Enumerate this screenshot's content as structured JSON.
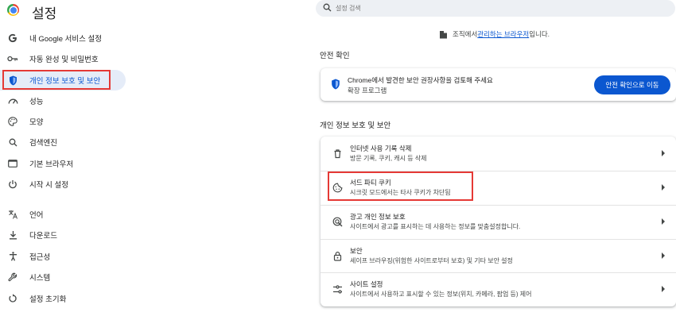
{
  "app": {
    "title": "설정"
  },
  "search": {
    "placeholder": "설정 검색"
  },
  "org_notice": {
    "prefix": "조직에서 ",
    "link": "관리하는 브라우저",
    "suffix": "입니다."
  },
  "sidebar": {
    "items": [
      {
        "label": "내 Google 서비스 설정",
        "icon": "google-g-icon"
      },
      {
        "label": "자동 완성 및 비밀번호",
        "icon": "key-icon"
      },
      {
        "label": "개인 정보 보호 및 보안",
        "icon": "shield-icon",
        "active": true
      },
      {
        "label": "성능",
        "icon": "speedometer-icon"
      },
      {
        "label": "모양",
        "icon": "palette-icon"
      },
      {
        "label": "검색엔진",
        "icon": "search-icon"
      },
      {
        "label": "기본 브라우저",
        "icon": "browser-window-icon"
      },
      {
        "label": "시작 시 설정",
        "icon": "power-icon"
      },
      {
        "label": "언어",
        "icon": "translate-icon"
      },
      {
        "label": "다운로드",
        "icon": "download-icon"
      },
      {
        "label": "접근성",
        "icon": "accessibility-icon"
      },
      {
        "label": "시스템",
        "icon": "wrench-icon"
      },
      {
        "label": "설정 초기화",
        "icon": "reset-icon"
      }
    ]
  },
  "safety_check": {
    "heading": "안전 확인",
    "title": "Chrome에서 발견한 보안 권장사항을 검토해 주세요",
    "subtitle": "확장 프로그램",
    "button": "안전 확인으로 이동"
  },
  "privacy": {
    "heading": "개인 정보 보호 및 보안",
    "rows": [
      {
        "title": "인터넷 사용 기록 삭제",
        "subtitle": "방문 기록, 쿠키, 캐시 등 삭제",
        "icon": "trash-icon"
      },
      {
        "title": "서드 파티 쿠키",
        "subtitle": "시크릿 모드에서는 타사 쿠키가 차단됨",
        "icon": "cookie-icon"
      },
      {
        "title": "광고 개인 정보 보호",
        "subtitle": "사이트에서 광고를 표시하는 데 사용하는 정보를 맞춤설정합니다.",
        "icon": "ad-privacy-icon"
      },
      {
        "title": "보안",
        "subtitle": "세이프 브라우징(위험한 사이트로부터 보호) 및 기타 보안 설정",
        "icon": "lock-icon"
      },
      {
        "title": "사이트 설정",
        "subtitle": "사이트에서 사용하고 표시할 수 있는 정보(위치, 카메라, 팝업 등) 제어",
        "icon": "sliders-icon"
      }
    ]
  },
  "colors": {
    "accent": "#0b57d0",
    "active_bg": "#e5ecf8",
    "highlight_box": "#e53935"
  }
}
